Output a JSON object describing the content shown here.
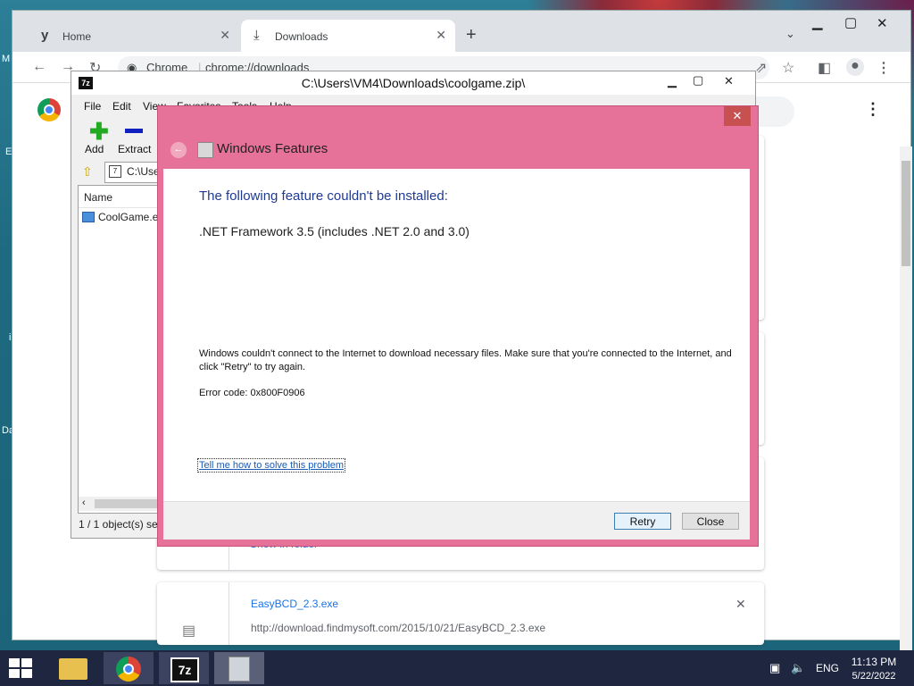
{
  "desktop": {
    "edge_letters": [
      "M",
      "E",
      "i",
      "Da"
    ]
  },
  "chrome": {
    "tabs": [
      {
        "label": "Home",
        "icon": "y-logo-icon"
      },
      {
        "label": "Downloads",
        "icon": "download-icon"
      }
    ],
    "new_tab": "+",
    "omnibox": {
      "site_label": "Chrome",
      "url": "chrome://downloads"
    },
    "downloads": [
      {
        "file_name": "EasyBCD_2.3.exe",
        "url": "http://download.findmysoft.com/2015/10/21/EasyBCD_2.3.exe",
        "remove": "✕"
      }
    ],
    "previous_card_action": "Show in folder"
  },
  "sevenzip": {
    "title": "C:\\Users\\VM4\\Downloads\\coolgame.zip\\",
    "menu": [
      "File",
      "Edit",
      "View",
      "Favorites",
      "Tools",
      "Help"
    ],
    "toolbar": {
      "add": "Add",
      "extract": "Extract"
    },
    "address": "C:\\Users",
    "column_name": "Name",
    "file": "CoolGame.e",
    "status": "1 / 1 object(s) sel"
  },
  "dialog": {
    "title": "Windows Features",
    "heading": "The following feature couldn't be installed:",
    "feature": ".NET Framework 3.5 (includes .NET 2.0 and 3.0)",
    "message": "Windows couldn't connect to the Internet to download necessary files. Make sure that you're connected to the Internet, and click \"Retry\" to try again.",
    "error_code": "Error code: 0x800F0906",
    "help_link": "Tell me how to solve this problem",
    "retry": "Retry",
    "close": "Close"
  },
  "taskbar": {
    "apps": [
      "file-explorer-icon",
      "chrome-icon",
      "7zip-icon",
      "windows-features-icon"
    ],
    "language": "ENG",
    "time": "11:13 PM",
    "date": "5/22/2022"
  }
}
